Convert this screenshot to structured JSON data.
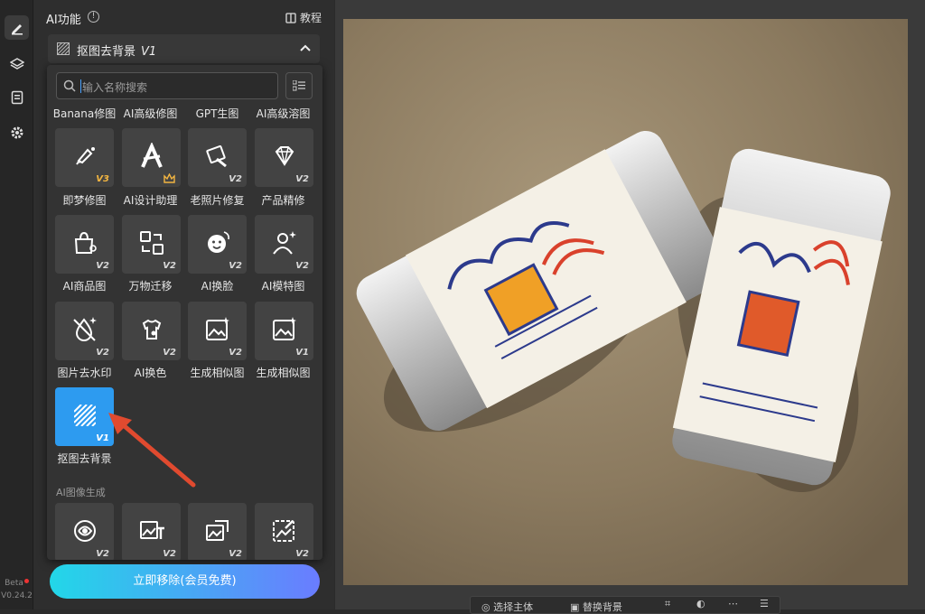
{
  "sidebar": {
    "beta_label": "Beta",
    "version": "V0.24.2",
    "icons": [
      "edit-icon",
      "layers-icon",
      "document-icon",
      "settings-icon"
    ]
  },
  "panel": {
    "title": "AI功能",
    "tutorial_label": "教程",
    "section_title": "抠图去背景",
    "section_version": "V1"
  },
  "search": {
    "placeholder": "输入名称搜索"
  },
  "tools_top_row": [
    "Banana修图",
    "AI高级修图",
    "GPT生图",
    "AI高级溶图"
  ],
  "tools": [
    {
      "label": "即梦修图",
      "version": "V3",
      "icon": "brush-icon"
    },
    {
      "label": "AI设计助理",
      "version": "",
      "icon": "letter-a-icon"
    },
    {
      "label": "老照片修复",
      "version": "V2",
      "icon": "photo-repair-icon"
    },
    {
      "label": "产品精修",
      "version": "V2",
      "icon": "gem-icon"
    },
    {
      "label": "AI商品图",
      "version": "V2",
      "icon": "shopping-bag-icon"
    },
    {
      "label": "万物迁移",
      "version": "V2",
      "icon": "transfer-icon"
    },
    {
      "label": "AI换脸",
      "version": "V2",
      "icon": "face-swap-icon"
    },
    {
      "label": "AI模特图",
      "version": "V2",
      "icon": "model-icon"
    },
    {
      "label": "图片去水印",
      "version": "V2",
      "icon": "watermark-remove-icon"
    },
    {
      "label": "AI换色",
      "version": "V2",
      "icon": "recolor-icon"
    },
    {
      "label": "生成相似图",
      "version": "V2",
      "icon": "similar-image-icon"
    },
    {
      "label": "生成相似图",
      "version": "V1",
      "icon": "similar-image-icon"
    },
    {
      "label": "抠图去背景",
      "version": "V1",
      "icon": "cutout-icon"
    }
  ],
  "group2": {
    "label": "AI图像生成",
    "tiles": [
      {
        "version": "V2",
        "icon": "swirl-icon"
      },
      {
        "version": "V2",
        "icon": "image-text-icon"
      },
      {
        "version": "V2",
        "icon": "image-swap-icon"
      },
      {
        "version": "V2",
        "icon": "image-edit-icon"
      }
    ]
  },
  "cta": {
    "label": "立即移除(会员免费)"
  },
  "toolbar": {
    "select_subject": "选择主体",
    "replace_bg": "替换背景"
  },
  "colors": {
    "accent_blue": "#2d9bf0",
    "gradient_start": "#22d7e8",
    "gradient_end": "#6a7cff",
    "version_gold": "#f2b541",
    "arrow_red": "#e04a2f"
  }
}
